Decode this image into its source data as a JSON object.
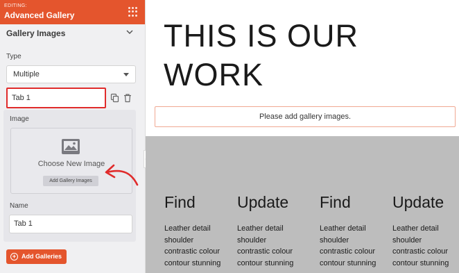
{
  "sidebar": {
    "editing_label": "EDITING:",
    "title": "Advanced Gallery",
    "section_title": "Gallery Images",
    "type_label": "Type",
    "type_value": "Multiple",
    "tab_value": "Tab 1",
    "image_label": "Image",
    "choose_image_text": "Choose New Image",
    "add_gallery_images_label": "Add Gallery Images",
    "name_label": "Name",
    "name_value": "Tab 1",
    "add_galleries_label": "Add Galleries"
  },
  "main": {
    "hero_title_line1": "THIS IS OUR",
    "hero_title_line2": "WORK",
    "gallery_notice": "Please add gallery images.",
    "columns": [
      {
        "title": "Find",
        "text": "Leather detail shoulder contrastic colour contour stunning"
      },
      {
        "title": "Update",
        "text": "Leather detail shoulder contrastic colour contour stunning"
      },
      {
        "title": "Find",
        "text": "Leather detail shoulder contrastic colour contour stunning"
      },
      {
        "title": "Update",
        "text": "Leather detail shoulder contrastic colour contour stunning"
      }
    ]
  },
  "colors": {
    "accent": "#e4552d",
    "highlight_red": "#e02b2b",
    "section_grey": "#bdbdbd"
  },
  "icons": [
    "grid-dots-icon",
    "chevron-down-icon",
    "caret-down-icon",
    "duplicate-icon",
    "trash-icon",
    "image-placeholder-icon",
    "plus-circle-icon",
    "chevron-left-icon",
    "annotation-arrow"
  ]
}
